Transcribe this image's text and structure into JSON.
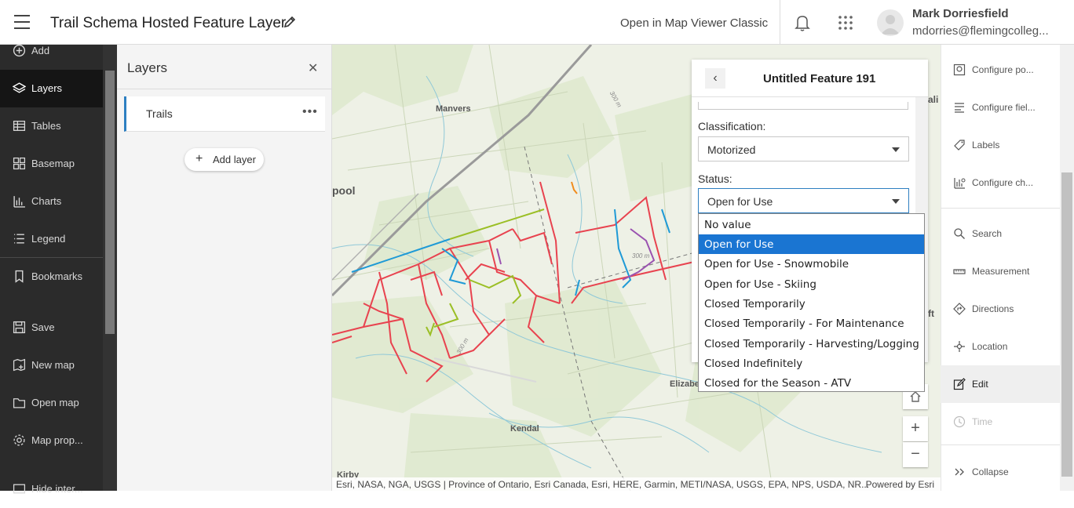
{
  "header": {
    "title": "Trail Schema Hosted Feature Layer",
    "open_classic": "Open in Map Viewer Classic",
    "user_name": "Mark Dorriesfield",
    "user_email": "mdorries@flemingcolleg..."
  },
  "leftnav": {
    "items": [
      {
        "label": "Add",
        "icon": "plus-circle-icon"
      },
      {
        "label": "Layers",
        "icon": "layers-icon"
      },
      {
        "label": "Tables",
        "icon": "table-icon"
      },
      {
        "label": "Basemap",
        "icon": "basemap-icon"
      },
      {
        "label": "Charts",
        "icon": "chart-icon"
      },
      {
        "label": "Legend",
        "icon": "legend-icon"
      },
      {
        "label": "Bookmarks",
        "icon": "bookmark-icon"
      },
      {
        "label": "Save",
        "icon": "save-icon"
      },
      {
        "label": "New map",
        "icon": "new-map-icon"
      },
      {
        "label": "Open map",
        "icon": "folder-icon"
      },
      {
        "label": "Map prop...",
        "icon": "gear-icon"
      },
      {
        "label": "Hide inter...",
        "icon": "hide-icon"
      }
    ]
  },
  "layers_panel": {
    "title": "Layers",
    "layer_name": "Trails",
    "add_layer": "Add layer"
  },
  "map": {
    "labels": {
      "manvers": "Manvers",
      "pool": "pool",
      "kendal": "Kendal",
      "kirby": "Kirby",
      "elizabeth": "Elizabe",
      "elev1": "300 m",
      "elev2": "300 m",
      "elev3": "300 m"
    },
    "attribution": "Esri, NASA, NGA, USGS | Province of Ontario, Esri Canada, Esri, HERE, Garmin, METI/NASA, USGS, EPA, NPS, USDA, NR...",
    "powered_by": "Powered by Esri",
    "side_letters": {
      "a": "ali",
      "f": "ft"
    }
  },
  "feature_panel": {
    "title": "Untitled Feature 191",
    "classification_label": "Classification:",
    "classification_value": "Motorized",
    "status_label": "Status:",
    "status_value": "Open for Use"
  },
  "status_dropdown": {
    "options": [
      "No value",
      "Open for Use",
      "Open for Use - Snowmobile",
      "Open for Use - Skiing",
      "Closed Temporarily",
      "Closed Temporarily - For Maintenance",
      "Closed Temporarily - Harvesting/Logging",
      "Closed Indefinitely",
      "Closed for the Season - ATV"
    ],
    "selected_index": 1
  },
  "rightbar": {
    "items": [
      {
        "label": "Configure po...",
        "icon": "configure-popup-icon"
      },
      {
        "label": "Configure fiel...",
        "icon": "configure-fields-icon"
      },
      {
        "label": "Labels",
        "icon": "labels-icon"
      },
      {
        "label": "Configure ch...",
        "icon": "configure-charts-icon"
      },
      {
        "label": "Search",
        "icon": "search-icon"
      },
      {
        "label": "Measurement",
        "icon": "measurement-icon"
      },
      {
        "label": "Directions",
        "icon": "directions-icon"
      },
      {
        "label": "Location",
        "icon": "location-icon"
      },
      {
        "label": "Edit",
        "icon": "edit-icon"
      },
      {
        "label": "Time",
        "icon": "clock-icon"
      },
      {
        "label": "Collapse",
        "icon": "collapse-icon"
      }
    ]
  },
  "colors": {
    "accent": "#1a75d2",
    "trail_red": "#e8434f",
    "trail_blue": "#1f9ad6",
    "trail_green": "#9bbf26",
    "trail_purple": "#9a52b0",
    "trail_orange": "#f08c1c"
  }
}
